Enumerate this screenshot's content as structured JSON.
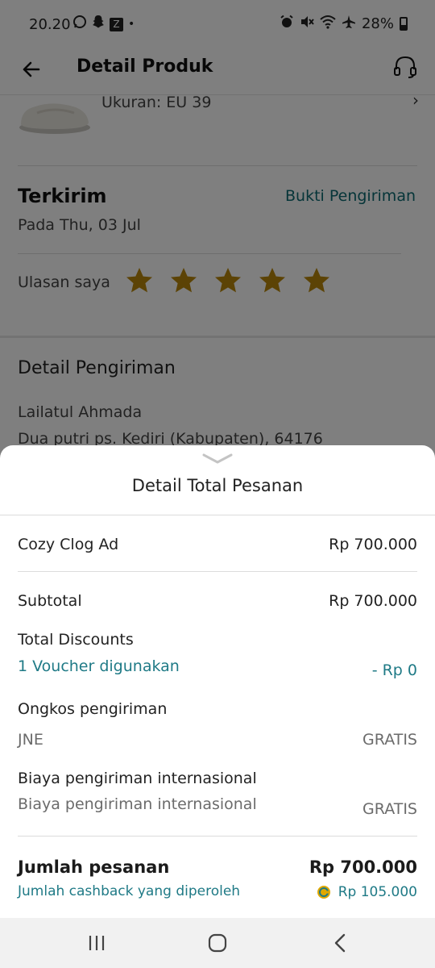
{
  "status_bar": {
    "time": "20.20",
    "battery": "28%",
    "left_icons": [
      "whatsapp-icon",
      "snapchat-icon",
      "z-app-icon",
      "dot-icon"
    ],
    "right_icons": [
      "alarm-icon",
      "mute-icon",
      "wifi-icon",
      "airplane-icon",
      "battery-icon"
    ]
  },
  "header": {
    "title": "Detail Produk"
  },
  "product": {
    "size": "Ukuran: EU 39"
  },
  "shipment_status": {
    "title": "Terkirim",
    "proof_link": "Bukti Pengiriman",
    "date": "Pada Thu, 03 Jul"
  },
  "review": {
    "label": "Ulasan saya",
    "rating": 5,
    "max": 5,
    "star_color": "#b8860b"
  },
  "shipping_detail": {
    "title": "Detail Pengiriman",
    "name": "Lailatul Ahmada",
    "address": "Dua putri ps. Kediri (Kabupaten), 64176"
  },
  "sheet": {
    "title": "Detail Total Pesanan",
    "item": {
      "name": "Cozy Clog Ad",
      "price": "Rp 700.000"
    },
    "subtotal": {
      "label": "Subtotal",
      "value": "Rp 700.000"
    },
    "discounts": {
      "label": "Total Discounts",
      "voucher": "1 Voucher digunakan",
      "value": "- Rp 0"
    },
    "shipping": {
      "label": "Ongkos pengiriman",
      "courier": "JNE",
      "value": "GRATIS"
    },
    "international": {
      "label": "Biaya pengiriman internasional",
      "sublabel": "Biaya pengiriman internasional",
      "value": "GRATIS"
    },
    "total": {
      "label": "Jumlah pesanan",
      "value": "Rp 700.000"
    },
    "cashback": {
      "label": "Jumlah cashback yang diperoleh",
      "value": "Rp 105.000"
    }
  },
  "colors": {
    "accent": "#1f7a86",
    "star": "#b8860b",
    "coin": "#e0a800"
  }
}
